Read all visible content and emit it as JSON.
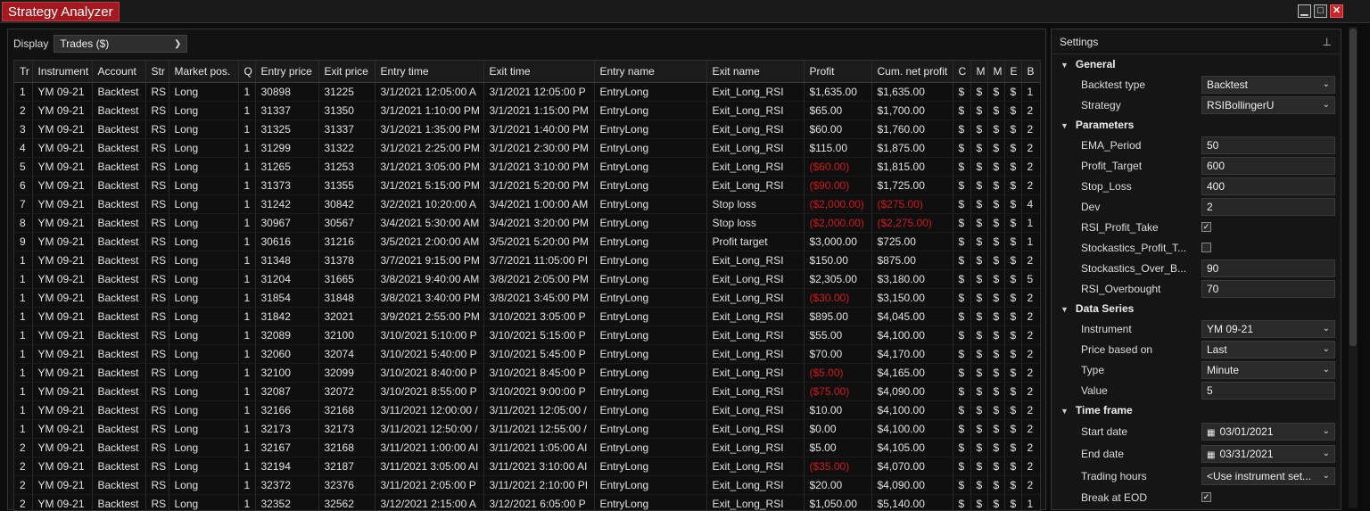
{
  "window": {
    "title": "Strategy Analyzer"
  },
  "display": {
    "label": "Display",
    "value": "Trades ($)"
  },
  "table": {
    "headers": [
      "Tr",
      "Instrument",
      "Account",
      "Str",
      "Market pos.",
      "Q",
      "Entry price",
      "Exit price",
      "Entry time",
      "Exit time",
      "Entry name",
      "Exit name",
      "Profit",
      "Cum. net profit",
      "C",
      "M",
      "M",
      "E",
      "B"
    ],
    "rows": [
      [
        "1",
        "YM 09-21",
        "Backtest",
        "RS",
        "Long",
        "1",
        "30898",
        "31225",
        "3/1/2021 12:05:00 A",
        "3/1/2021 12:05:00 P",
        "EntryLong",
        "Exit_Long_RSI",
        "$1,635.00",
        "$1,635.00",
        "$",
        "$",
        "$",
        "$",
        "1"
      ],
      [
        "2",
        "YM 09-21",
        "Backtest",
        "RS",
        "Long",
        "1",
        "31337",
        "31350",
        "3/1/2021 1:10:00 PM",
        "3/1/2021 1:15:00 PM",
        "EntryLong",
        "Exit_Long_RSI",
        "$65.00",
        "$1,700.00",
        "$",
        "$",
        "$",
        "$",
        "2"
      ],
      [
        "3",
        "YM 09-21",
        "Backtest",
        "RS",
        "Long",
        "1",
        "31325",
        "31337",
        "3/1/2021 1:35:00 PM",
        "3/1/2021 1:40:00 PM",
        "EntryLong",
        "Exit_Long_RSI",
        "$60.00",
        "$1,760.00",
        "$",
        "$",
        "$",
        "$",
        "2"
      ],
      [
        "4",
        "YM 09-21",
        "Backtest",
        "RS",
        "Long",
        "1",
        "31299",
        "31322",
        "3/1/2021 2:25:00 PM",
        "3/1/2021 2:30:00 PM",
        "EntryLong",
        "Exit_Long_RSI",
        "$115.00",
        "$1,875.00",
        "$",
        "$",
        "$",
        "$",
        "2"
      ],
      [
        "5",
        "YM 09-21",
        "Backtest",
        "RS",
        "Long",
        "1",
        "31265",
        "31253",
        "3/1/2021 3:05:00 PM",
        "3/1/2021 3:10:00 PM",
        "EntryLong",
        "Exit_Long_RSI",
        "($60.00)",
        "$1,815.00",
        "$",
        "$",
        "$",
        "$",
        "2"
      ],
      [
        "6",
        "YM 09-21",
        "Backtest",
        "RS",
        "Long",
        "1",
        "31373",
        "31355",
        "3/1/2021 5:15:00 PM",
        "3/1/2021 5:20:00 PM",
        "EntryLong",
        "Exit_Long_RSI",
        "($90.00)",
        "$1,725.00",
        "$",
        "$",
        "$",
        "$",
        "2"
      ],
      [
        "7",
        "YM 09-21",
        "Backtest",
        "RS",
        "Long",
        "1",
        "31242",
        "30842",
        "3/2/2021 10:20:00 A",
        "3/4/2021 1:00:00 AM",
        "EntryLong",
        "Stop loss",
        "($2,000.00)",
        "($275.00)",
        "$",
        "$",
        "$",
        "$",
        "4"
      ],
      [
        "8",
        "YM 09-21",
        "Backtest",
        "RS",
        "Long",
        "1",
        "30967",
        "30567",
        "3/4/2021 5:30:00 AM",
        "3/4/2021 3:20:00 PM",
        "EntryLong",
        "Stop loss",
        "($2,000.00)",
        "($2,275.00)",
        "$",
        "$",
        "$",
        "$",
        "1"
      ],
      [
        "9",
        "YM 09-21",
        "Backtest",
        "RS",
        "Long",
        "1",
        "30616",
        "31216",
        "3/5/2021 2:00:00 AM",
        "3/5/2021 5:20:00 PM",
        "EntryLong",
        "Profit target",
        "$3,000.00",
        "$725.00",
        "$",
        "$",
        "$",
        "$",
        "1"
      ],
      [
        "1",
        "YM 09-21",
        "Backtest",
        "RS",
        "Long",
        "1",
        "31348",
        "31378",
        "3/7/2021 9:15:00 PM",
        "3/7/2021 11:05:00 PI",
        "EntryLong",
        "Exit_Long_RSI",
        "$150.00",
        "$875.00",
        "$",
        "$",
        "$",
        "$",
        "2"
      ],
      [
        "1",
        "YM 09-21",
        "Backtest",
        "RS",
        "Long",
        "1",
        "31204",
        "31665",
        "3/8/2021 9:40:00 AM",
        "3/8/2021 2:05:00 PM",
        "EntryLong",
        "Exit_Long_RSI",
        "$2,305.00",
        "$3,180.00",
        "$",
        "$",
        "$",
        "$",
        "5"
      ],
      [
        "1",
        "YM 09-21",
        "Backtest",
        "RS",
        "Long",
        "1",
        "31854",
        "31848",
        "3/8/2021 3:40:00 PM",
        "3/8/2021 3:45:00 PM",
        "EntryLong",
        "Exit_Long_RSI",
        "($30.00)",
        "$3,150.00",
        "$",
        "$",
        "$",
        "$",
        "2"
      ],
      [
        "1",
        "YM 09-21",
        "Backtest",
        "RS",
        "Long",
        "1",
        "31842",
        "32021",
        "3/9/2021 2:55:00 PM",
        "3/10/2021 3:05:00 P",
        "EntryLong",
        "Exit_Long_RSI",
        "$895.00",
        "$4,045.00",
        "$",
        "$",
        "$",
        "$",
        "2"
      ],
      [
        "1",
        "YM 09-21",
        "Backtest",
        "RS",
        "Long",
        "1",
        "32089",
        "32100",
        "3/10/2021 5:10:00 P",
        "3/10/2021 5:15:00 P",
        "EntryLong",
        "Exit_Long_RSI",
        "$55.00",
        "$4,100.00",
        "$",
        "$",
        "$",
        "$",
        "2"
      ],
      [
        "1",
        "YM 09-21",
        "Backtest",
        "RS",
        "Long",
        "1",
        "32060",
        "32074",
        "3/10/2021 5:40:00 P",
        "3/10/2021 5:45:00 P",
        "EntryLong",
        "Exit_Long_RSI",
        "$70.00",
        "$4,170.00",
        "$",
        "$",
        "$",
        "$",
        "2"
      ],
      [
        "1",
        "YM 09-21",
        "Backtest",
        "RS",
        "Long",
        "1",
        "32100",
        "32099",
        "3/10/2021 8:40:00 P",
        "3/10/2021 8:45:00 P",
        "EntryLong",
        "Exit_Long_RSI",
        "($5.00)",
        "$4,165.00",
        "$",
        "$",
        "$",
        "$",
        "2"
      ],
      [
        "1",
        "YM 09-21",
        "Backtest",
        "RS",
        "Long",
        "1",
        "32087",
        "32072",
        "3/10/2021 8:55:00 P",
        "3/10/2021 9:00:00 P",
        "EntryLong",
        "Exit_Long_RSI",
        "($75.00)",
        "$4,090.00",
        "$",
        "$",
        "$",
        "$",
        "2"
      ],
      [
        "1",
        "YM 09-21",
        "Backtest",
        "RS",
        "Long",
        "1",
        "32166",
        "32168",
        "3/11/2021 12:00:00 /",
        "3/11/2021 12:05:00 /",
        "EntryLong",
        "Exit_Long_RSI",
        "$10.00",
        "$4,100.00",
        "$",
        "$",
        "$",
        "$",
        "2"
      ],
      [
        "1",
        "YM 09-21",
        "Backtest",
        "RS",
        "Long",
        "1",
        "32173",
        "32173",
        "3/11/2021 12:50:00 /",
        "3/11/2021 12:55:00 /",
        "EntryLong",
        "Exit_Long_RSI",
        "$0.00",
        "$4,100.00",
        "$",
        "$",
        "$",
        "$",
        "2"
      ],
      [
        "2",
        "YM 09-21",
        "Backtest",
        "RS",
        "Long",
        "1",
        "32167",
        "32168",
        "3/11/2021 1:00:00 AI",
        "3/11/2021 1:05:00 AI",
        "EntryLong",
        "Exit_Long_RSI",
        "$5.00",
        "$4,105.00",
        "$",
        "$",
        "$",
        "$",
        "2"
      ],
      [
        "2",
        "YM 09-21",
        "Backtest",
        "RS",
        "Long",
        "1",
        "32194",
        "32187",
        "3/11/2021 3:05:00 AI",
        "3/11/2021 3:10:00 AI",
        "EntryLong",
        "Exit_Long_RSI",
        "($35.00)",
        "$4,070.00",
        "$",
        "$",
        "$",
        "$",
        "2"
      ],
      [
        "2",
        "YM 09-21",
        "Backtest",
        "RS",
        "Long",
        "1",
        "32372",
        "32376",
        "3/11/2021 2:05:00 P",
        "3/11/2021 2:10:00 PI",
        "EntryLong",
        "Exit_Long_RSI",
        "$20.00",
        "$4,090.00",
        "$",
        "$",
        "$",
        "$",
        "2"
      ],
      [
        "2",
        "YM 09-21",
        "Backtest",
        "RS",
        "Long",
        "1",
        "32352",
        "32562",
        "3/12/2021 2:15:00 A",
        "3/12/2021 6:05:00 P",
        "EntryLong",
        "Exit_Long_RSI",
        "$1,050.00",
        "$5,140.00",
        "$",
        "$",
        "$",
        "$",
        "1"
      ]
    ]
  },
  "settings": {
    "title": "Settings",
    "general": {
      "label": "General",
      "backtest_type_label": "Backtest type",
      "backtest_type_value": "Backtest",
      "strategy_label": "Strategy",
      "strategy_value": "RSIBollingerU"
    },
    "parameters": {
      "label": "Parameters",
      "items": [
        {
          "name": "EMA_Period",
          "value": "50"
        },
        {
          "name": "Profit_Target",
          "value": "600"
        },
        {
          "name": "Stop_Loss",
          "value": "400"
        },
        {
          "name": "Dev",
          "value": "2"
        }
      ],
      "rsi_profit_take_label": "RSI_Profit_Take",
      "rsi_profit_take_checked": true,
      "stoch_profit_label": "Stockastics_Profit_T...",
      "stoch_profit_checked": false,
      "stoch_over_label": "Stockastics_Over_B...",
      "stoch_over_value": "90",
      "rsi_overbought_label": "RSI_Overbought",
      "rsi_overbought_value": "70"
    },
    "data_series": {
      "label": "Data Series",
      "instrument_label": "Instrument",
      "instrument_value": "YM 09-21",
      "price_label": "Price based on",
      "price_value": "Last",
      "type_label": "Type",
      "type_value": "Minute",
      "value_label": "Value",
      "value_value": "5"
    },
    "time_frame": {
      "label": "Time frame",
      "start_label": "Start date",
      "start_value": "03/01/2021",
      "end_label": "End date",
      "end_value": "03/31/2021",
      "hours_label": "Trading hours",
      "hours_value": "<Use instrument set...",
      "eod_label": "Break at EOD",
      "eod_checked": true
    }
  }
}
